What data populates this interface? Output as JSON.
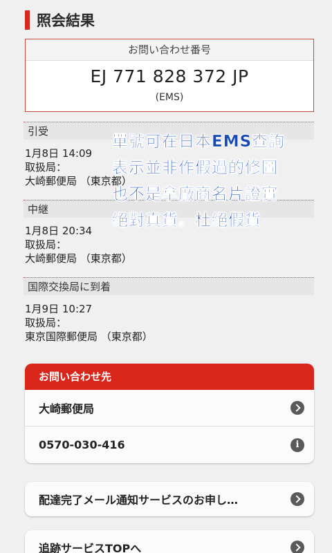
{
  "section_title": "照会結果",
  "tracking": {
    "label": "お問い合わせ番号",
    "number": "EJ 771 828 372 JP",
    "service": "(EMS)"
  },
  "events": [
    {
      "status": "引受",
      "datetime": "1月8日 14:09",
      "handler_label": "取扱局：",
      "office": "大崎郵便局 （東京都）"
    },
    {
      "status": "中継",
      "datetime": "1月8日 20:34",
      "handler_label": "取扱局：",
      "office": "大崎郵便局 （東京都）"
    },
    {
      "status": "国際交換局に到着",
      "datetime": "1月9日 10:27",
      "handler_label": "取扱局：",
      "office": "東京国際郵便局 （東京都）"
    }
  ],
  "overlay_text": [
    "單號可在日本EMS查詢",
    "表示並非作假過的修圖",
    "也不是拿廠商名片證實",
    "絕對真貨。杜絕假貨"
  ],
  "contact": {
    "header": "お問い合わせ先",
    "office": "大崎郵便局",
    "phone": "0570-030-416",
    "office_icon": "chevron-right-icon",
    "phone_icon": "info-icon"
  },
  "links": {
    "mail_notify": "配達完了メール通知サービスのお申し…",
    "tracking_top": "追跡サービスTOPへ"
  },
  "colors": {
    "accent_red": "#d8261a",
    "overlay_blue": "#1749b8"
  }
}
